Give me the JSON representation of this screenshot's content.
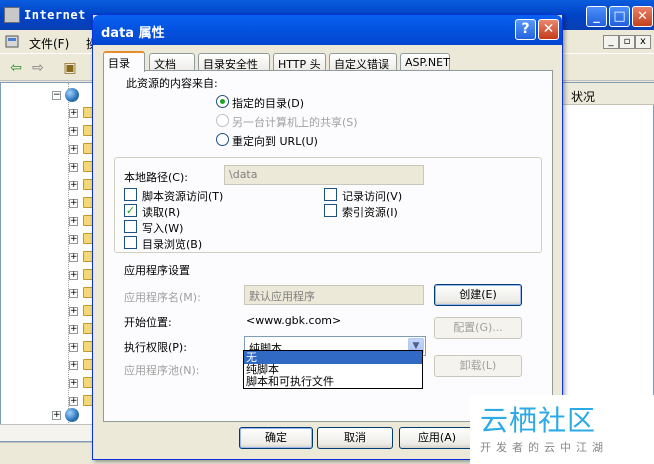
{
  "background_window": {
    "title": "Internet",
    "menu": {
      "file": "文件(F)",
      "next": "操"
    },
    "list_header_status": "状况"
  },
  "dialog": {
    "title": "data 属性",
    "help_glyph": "?",
    "close_glyph": "✕",
    "tabs": [
      "目录",
      "文档",
      "目录安全性",
      "HTTP 头",
      "自定义错误",
      "ASP.NET"
    ],
    "content_source": {
      "heading": "此资源的内容来自:",
      "options": [
        {
          "label": "指定的目录(D)",
          "checked": true,
          "enabled": true
        },
        {
          "label": "另一台计算机上的共享(S)",
          "checked": false,
          "enabled": false
        },
        {
          "label": "重定向到 URL(U)",
          "checked": false,
          "enabled": true
        }
      ]
    },
    "local_path": {
      "label": "本地路径(C):",
      "value": "\\data"
    },
    "permissions": [
      {
        "label": "脚本资源访问(T)",
        "checked": false
      },
      {
        "label": "读取(R)",
        "checked": true
      },
      {
        "label": "写入(W)",
        "checked": false
      },
      {
        "label": "目录浏览(B)",
        "checked": false
      },
      {
        "label": "记录访问(V)",
        "checked": false
      },
      {
        "label": "索引资源(I)",
        "checked": false
      }
    ],
    "app_settings": {
      "heading": "应用程序设置",
      "app_name_label": "应用程序名(M):",
      "app_name_value": "默认应用程序",
      "create_button": "创建(E)",
      "start_point_label": "开始位置:",
      "start_point_value": "<www.gbk.com>",
      "config_button": "配置(G)...",
      "exec_perm_label": "执行权限(P):",
      "exec_perm_value": "纯脚本",
      "exec_perm_options": [
        "无",
        "纯脚本",
        "脚本和可执行文件"
      ],
      "app_pool_label": "应用程序池(N):",
      "unload_button": "卸载(L)"
    },
    "buttons": {
      "ok": "确定",
      "cancel": "取消",
      "apply": "应用(A)"
    }
  },
  "watermark": {
    "text": "云栖社区",
    "sub": "开发者的云中江湖"
  },
  "colors": {
    "titlebar": "#0454e3",
    "dialog_bg": "#ece9d8",
    "selection": "#316ac5",
    "check_green": "#21a121"
  }
}
